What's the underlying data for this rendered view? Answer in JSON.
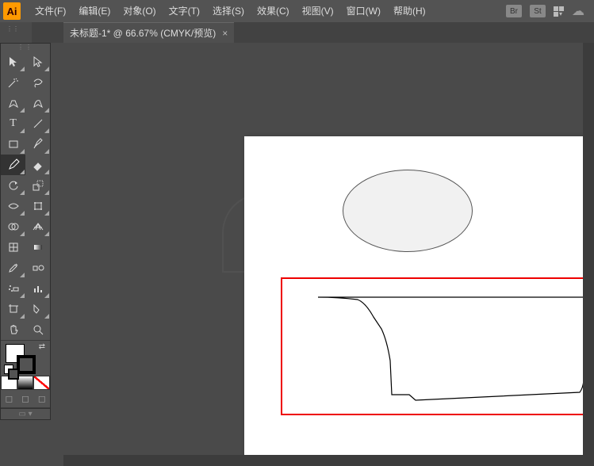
{
  "app": {
    "logo": "Ai"
  },
  "menu": {
    "items": [
      "文件(F)",
      "编辑(E)",
      "对象(O)",
      "文字(T)",
      "选择(S)",
      "效果(C)",
      "视图(V)",
      "窗口(W)",
      "帮助(H)"
    ],
    "right": {
      "br": "Br",
      "st": "St"
    }
  },
  "tab": {
    "title": "未标题-1* @ 66.67% (CMYK/预览)",
    "close": "×"
  },
  "tools": {
    "rows": [
      [
        "selection",
        "direct-selection"
      ],
      [
        "magic-wand",
        "lasso"
      ],
      [
        "pen",
        "curvature"
      ],
      [
        "type",
        "line-segment"
      ],
      [
        "rectangle",
        "paintbrush"
      ],
      [
        "pencil",
        "eraser"
      ],
      [
        "rotate",
        "scale"
      ],
      [
        "width",
        "free-transform"
      ],
      [
        "shape-builder",
        "perspective"
      ],
      [
        "mesh",
        "gradient"
      ],
      [
        "eyedropper",
        "blend"
      ],
      [
        "symbol-sprayer",
        "column-graph"
      ],
      [
        "artboard",
        "slice"
      ],
      [
        "hand",
        "zoom"
      ]
    ],
    "active": "pencil"
  },
  "colors": {
    "fill": "#ffffff",
    "stroke": "#000000"
  },
  "canvas": {
    "shapes": {
      "ellipse": {
        "fill": "#f1f1f1",
        "stroke": "#555555"
      },
      "highlight_box": {
        "stroke": "#ee0000"
      }
    }
  }
}
